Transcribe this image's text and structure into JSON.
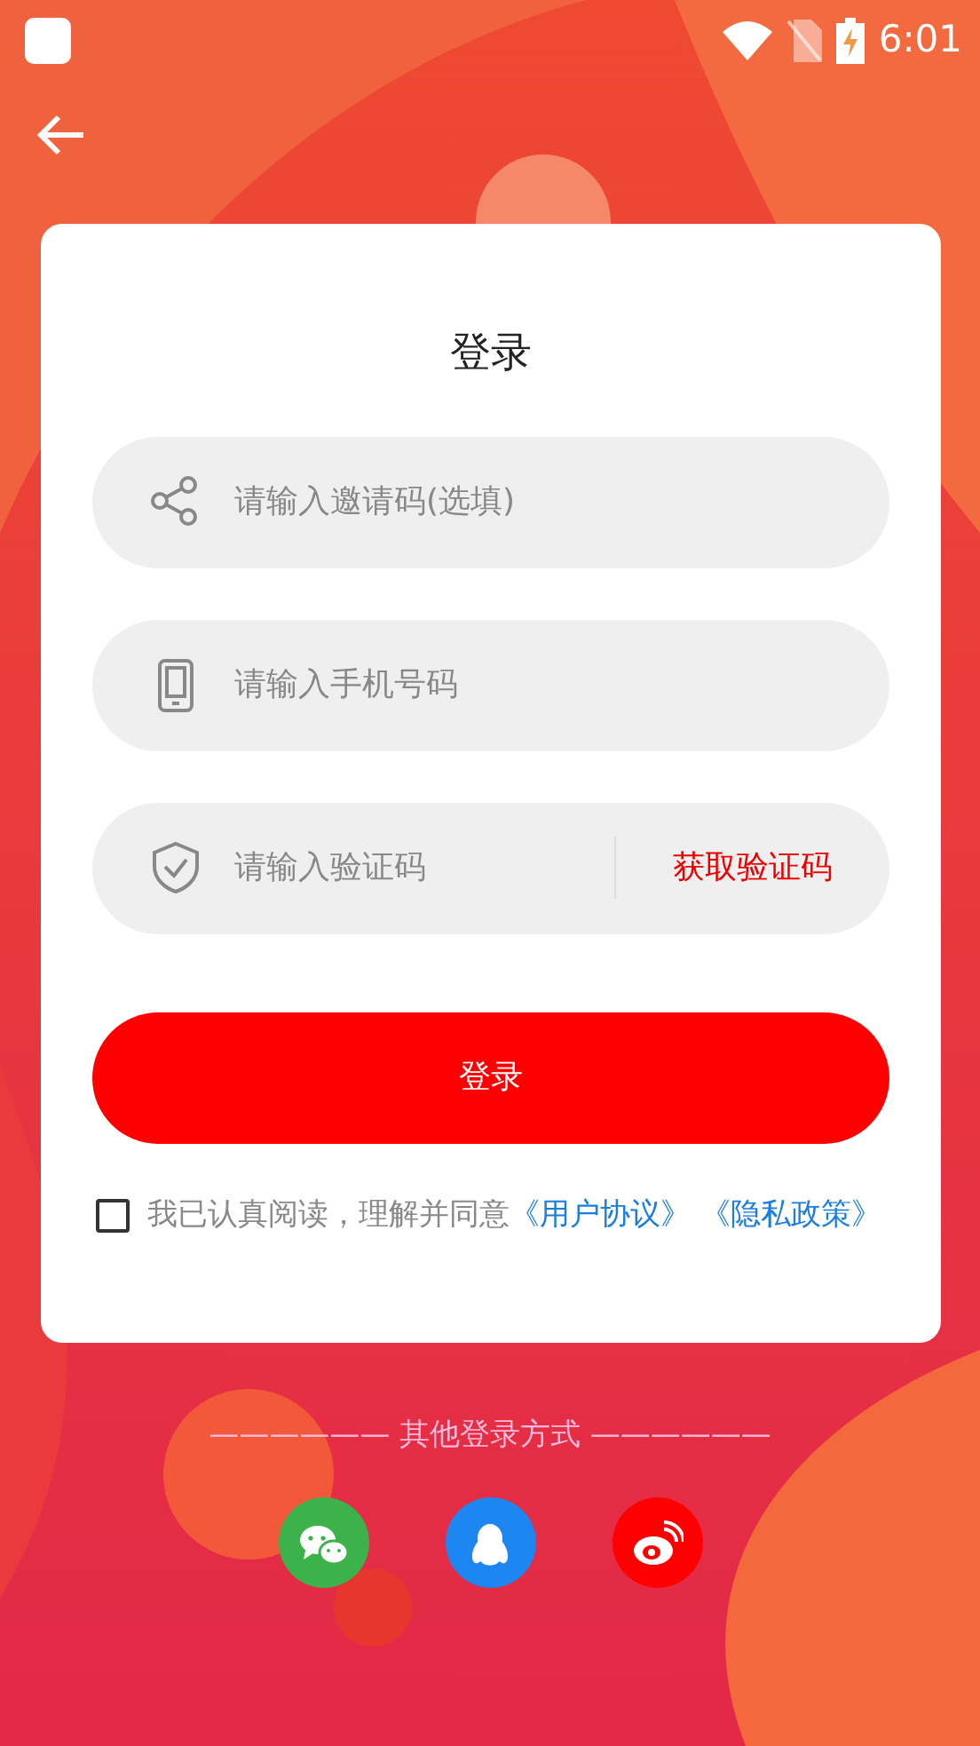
{
  "status_bar": {
    "time": "6:01"
  },
  "title": "登录",
  "fields": [
    {
      "kind": "invite",
      "placeholder": "请输入邀请码(选填)"
    },
    {
      "kind": "phone",
      "placeholder": "请输入手机号码"
    },
    {
      "kind": "code",
      "placeholder": "请输入验证码",
      "action": "获取验证码"
    }
  ],
  "login_button": "登录",
  "agreement": {
    "checked": false,
    "text": "我已认真阅读，理解并同意",
    "links": [
      "《用户协议》",
      "《隐私政策》"
    ]
  },
  "other_login": {
    "label": "—————— 其他登录方式 ——————",
    "providers": [
      {
        "kind": "wechat"
      },
      {
        "kind": "qq"
      },
      {
        "kind": "weibo"
      }
    ]
  }
}
